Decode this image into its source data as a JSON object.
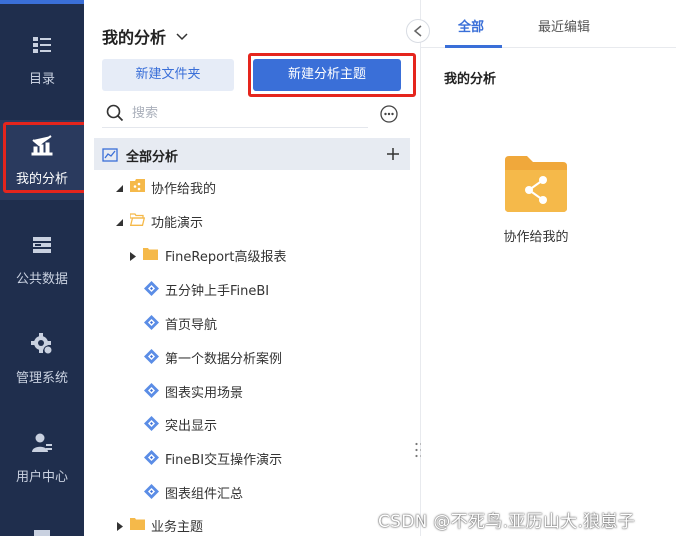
{
  "nav": {
    "items": [
      {
        "label": "目录",
        "icon": "catalog-icon"
      },
      {
        "label": "我的分析",
        "icon": "analysis-chart-icon",
        "active": true
      },
      {
        "label": "公共数据",
        "icon": "database-icon"
      },
      {
        "label": "管理系统",
        "icon": "settings-gear-icon"
      },
      {
        "label": "用户中心",
        "icon": "user-center-icon"
      }
    ]
  },
  "panel": {
    "title": "我的分析",
    "new_folder_label": "新建文件夹",
    "new_theme_label": "新建分析主题",
    "search_placeholder": "搜索",
    "tree_root_label": "全部分析",
    "tree": [
      {
        "label": "协作给我的",
        "type": "shared-folder",
        "expanded": true,
        "level": 1
      },
      {
        "label": "功能演示",
        "type": "folder-open",
        "expanded": true,
        "level": 1
      },
      {
        "label": "FineReport高级报表",
        "type": "folder",
        "expanded": false,
        "level": 2
      },
      {
        "label": "五分钟上手FineBI",
        "type": "theme",
        "level": 3
      },
      {
        "label": "首页导航",
        "type": "theme",
        "level": 3
      },
      {
        "label": "第一个数据分析案例",
        "type": "theme",
        "level": 3
      },
      {
        "label": "图表实用场景",
        "type": "theme",
        "level": 3
      },
      {
        "label": "突出显示",
        "type": "theme",
        "level": 3
      },
      {
        "label": "FineBI交互操作演示",
        "type": "theme",
        "level": 3
      },
      {
        "label": "图表组件汇总",
        "type": "theme",
        "level": 3
      },
      {
        "label": "业务主题",
        "type": "folder",
        "expanded": false,
        "level": 1
      }
    ]
  },
  "content": {
    "tabs": [
      {
        "label": "全部",
        "active": true
      },
      {
        "label": "最近编辑",
        "active": false
      }
    ],
    "section_title": "我的分析",
    "folder_label": "协作给我的"
  },
  "watermark": "CSDN @不死鸟.亚历山大.狼崽子",
  "colors": {
    "nav_bg": "#1f2e4d",
    "accent": "#3a6fd8",
    "highlight_box": "#e5251d",
    "folder": "#f5b94a"
  }
}
